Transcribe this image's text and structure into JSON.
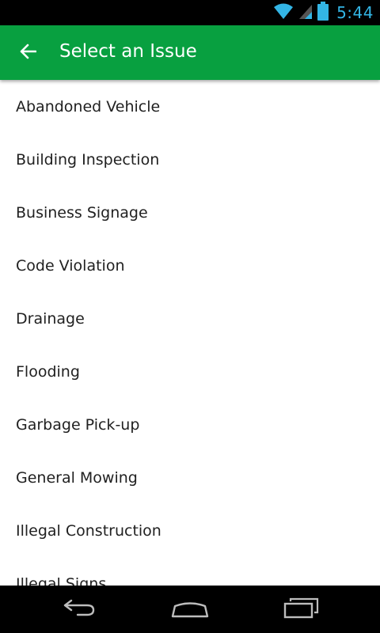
{
  "status_bar": {
    "time": "5:44",
    "icons": [
      "wifi-icon",
      "signal-icon",
      "battery-icon"
    ],
    "accent_color": "#33b5e5"
  },
  "app_bar": {
    "title": "Select an Issue",
    "back_icon": "arrow-back-icon",
    "color": "#08a040"
  },
  "issues": [
    "Abandoned Vehicle",
    "Building Inspection",
    "Business Signage",
    "Code Violation",
    "Drainage",
    "Flooding",
    "Garbage Pick-up",
    "General Mowing",
    "Illegal Construction",
    "Illegal Signs"
  ],
  "nav_bar": {
    "icons": [
      "back-icon",
      "home-icon",
      "recent-apps-icon"
    ]
  }
}
